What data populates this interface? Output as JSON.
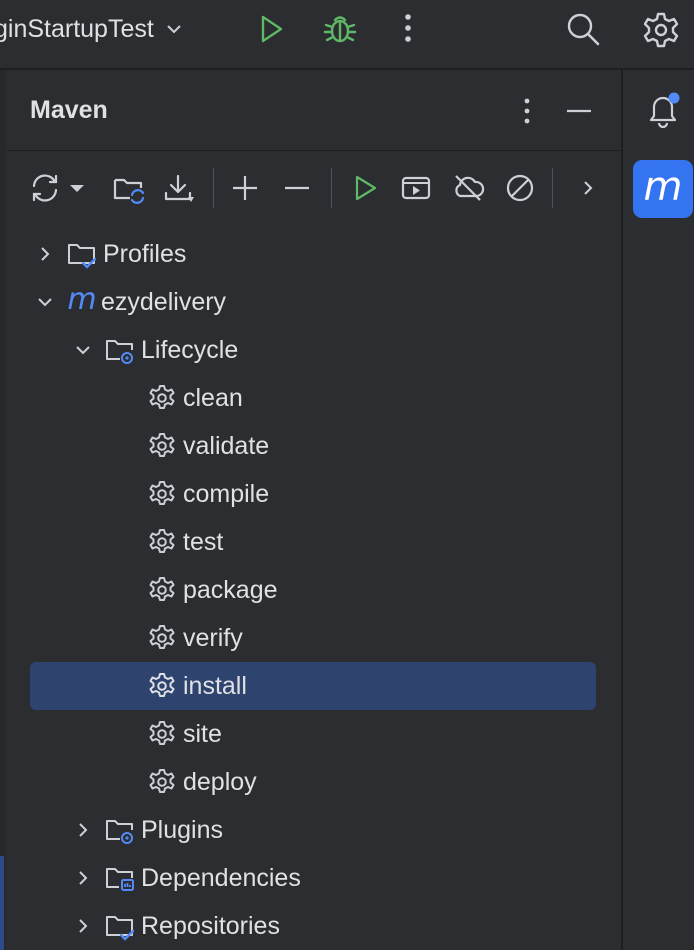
{
  "top_bar": {
    "run_config": "ginStartupTest",
    "icons": [
      "chevron-down-icon",
      "run-icon",
      "debug-icon",
      "more-vertical-icon",
      "search-icon",
      "settings-icon"
    ],
    "accent_run": "#4ca85b"
  },
  "maven_window": {
    "title": "Maven",
    "toolbar_icons": [
      "reload-icon",
      "dropdown-arrow-icon",
      "folder-sync-icon",
      "download-icon",
      "add-icon",
      "remove-icon",
      "run-icon",
      "run-config-icon",
      "offline-icon",
      "skip-tests-icon",
      "more-chevron-icon"
    ],
    "tree": [
      {
        "label": "Profiles",
        "icon": "profiles-folder-icon",
        "expanded": false,
        "level": 0
      },
      {
        "label": "ezydelivery",
        "icon": "maven-project-icon",
        "expanded": true,
        "level": 0
      },
      {
        "label": "Lifecycle",
        "icon": "lifecycle-folder-icon",
        "expanded": true,
        "level": 1
      },
      {
        "label": "clean",
        "icon": "gear-icon",
        "level": 2
      },
      {
        "label": "validate",
        "icon": "gear-icon",
        "level": 2
      },
      {
        "label": "compile",
        "icon": "gear-icon",
        "level": 2
      },
      {
        "label": "test",
        "icon": "gear-icon",
        "level": 2
      },
      {
        "label": "package",
        "icon": "gear-icon",
        "level": 2
      },
      {
        "label": "verify",
        "icon": "gear-icon",
        "level": 2
      },
      {
        "label": "install",
        "icon": "gear-icon",
        "level": 2,
        "selected": true
      },
      {
        "label": "site",
        "icon": "gear-icon",
        "level": 2
      },
      {
        "label": "deploy",
        "icon": "gear-icon",
        "level": 2
      },
      {
        "label": "Plugins",
        "icon": "plugins-folder-icon",
        "expanded": false,
        "level": 1
      },
      {
        "label": "Dependencies",
        "icon": "dependencies-folder-icon",
        "expanded": false,
        "level": 1
      },
      {
        "label": "Repositories",
        "icon": "repositories-folder-icon",
        "expanded": false,
        "level": 1
      }
    ],
    "selection_color": "#2e436e"
  },
  "right_stripe": {
    "maven_button_letter": "m",
    "maven_button_color": "#3574f0",
    "notification_dot_color": "#548af7"
  }
}
